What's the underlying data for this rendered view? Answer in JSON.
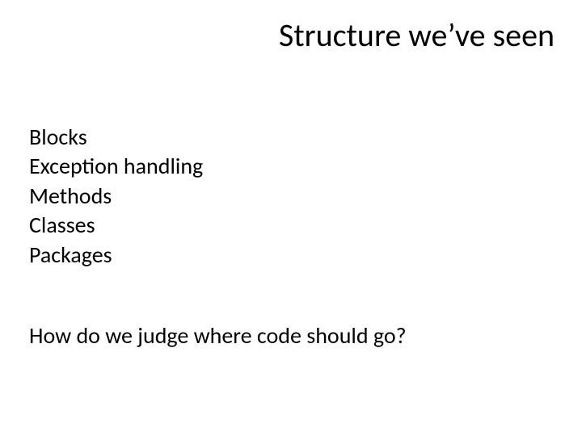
{
  "title": "Structure we’ve seen",
  "items": {
    "0": "Blocks",
    "1": "Exception handling",
    "2": "Methods",
    "3": "Classes",
    "4": "Packages"
  },
  "question": "How do we judge where code should go?"
}
